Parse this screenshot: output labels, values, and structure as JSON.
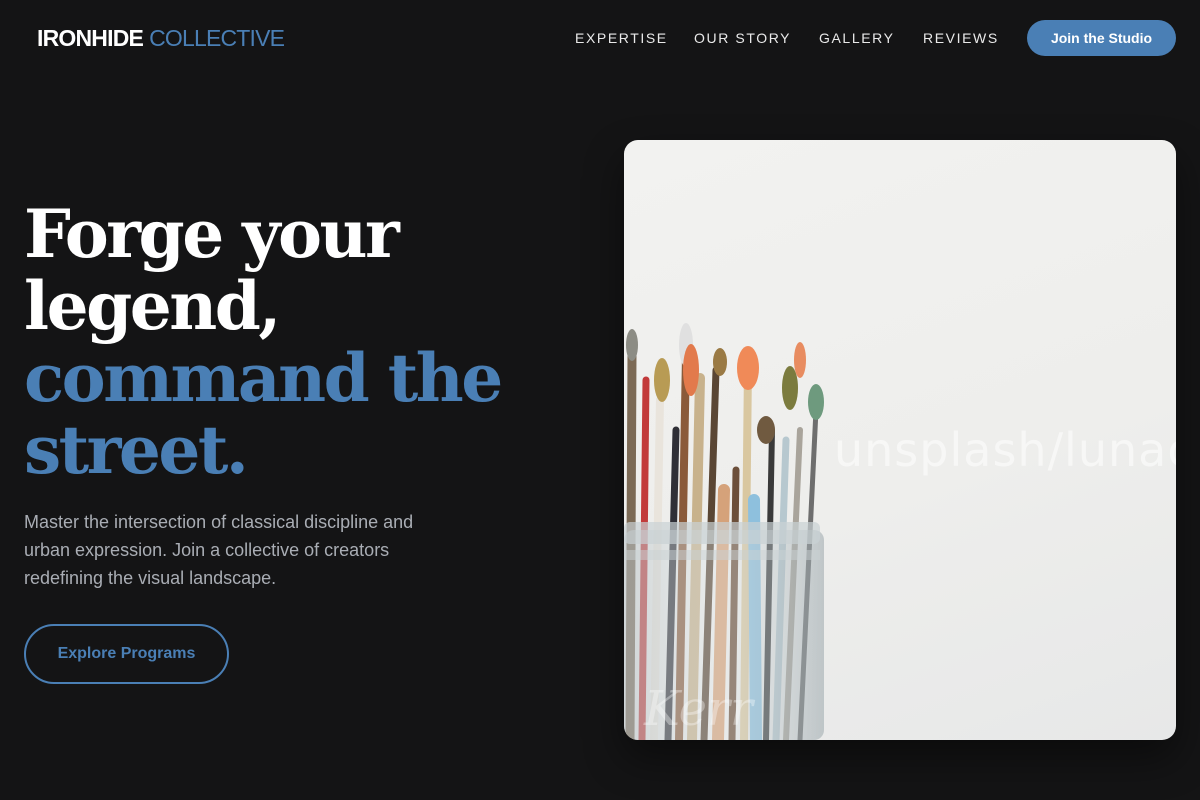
{
  "brand": {
    "part1": "IRONHIDE",
    "part2": "COLLECTIVE"
  },
  "nav": {
    "items": [
      "EXPERTISE",
      "OUR STORY",
      "GALLERY",
      "REVIEWS"
    ],
    "cta_label": "Join the Studio"
  },
  "hero": {
    "headline_line1": "Forge your",
    "headline_line2": "legend,",
    "headline_line3": "command the",
    "headline_line4": "street.",
    "subcopy": "Master the intersection of classical discipline and urban expression. Join a collective of creators redefining the visual landscape.",
    "button_label": "Explore Programs"
  },
  "photo": {
    "subject": "paint-brushes-in-glass-jar",
    "watermark": "unsplash/lunaceros.tokyo"
  },
  "colors": {
    "background": "#141415",
    "accent": "#4a7fb5",
    "text": "#ffffff",
    "muted_text": "#a9adb4"
  }
}
